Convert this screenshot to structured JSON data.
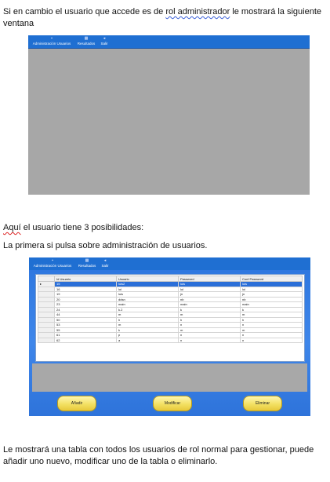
{
  "intro": {
    "text1": "Si en cambio el usuario que accede es de ",
    "text2": "rol  administrador",
    "text3": " le mostrará la siguiente ventana"
  },
  "window1": {
    "menu": [
      {
        "label": "Administración Usuarios",
        "icon": "users-icon"
      },
      {
        "label": "Resultados",
        "icon": "chart-icon"
      },
      {
        "label": "Salir",
        "icon": "exit-icon"
      }
    ]
  },
  "para2": {
    "word": "Aquí",
    "rest": " el usuario tiene 3 posibilidades:"
  },
  "para3": {
    "text": "La primera si pulsa sobre administración de usuarios."
  },
  "window2": {
    "menu": [
      {
        "label": "Administración Usuarios",
        "icon": "users-icon"
      },
      {
        "label": "Resultados",
        "icon": "chart-icon"
      },
      {
        "label": "Salir",
        "icon": "exit-icon"
      }
    ],
    "columns": [
      "Id Usuario",
      "Usuario",
      "Password",
      "Conf Password"
    ],
    "rows": [
      [
        "15",
        "luis2",
        "luis",
        "luis"
      ],
      [
        "16",
        "lol",
        "lol",
        "lol"
      ],
      [
        "19",
        "luis",
        "jn",
        "jn"
      ],
      [
        "20",
        "ddsn",
        "nb",
        "nb"
      ],
      [
        "23",
        "main",
        "main",
        "main"
      ],
      [
        "24",
        "k.2",
        "k",
        "k"
      ],
      [
        "44",
        "m",
        "m",
        "m"
      ],
      [
        "50",
        "h",
        "h",
        "h"
      ],
      [
        "53",
        "m",
        "n",
        "n"
      ],
      [
        "55",
        "k",
        "m",
        "m"
      ],
      [
        "61",
        "p",
        "n",
        "n"
      ],
      [
        "62",
        "a",
        "n",
        "n"
      ]
    ],
    "buttons": {
      "add": "Añadir",
      "modify": "Modificar",
      "delete": "Eliminar"
    }
  },
  "para4": {
    "text": "Le mostrará una tabla con todos los usuarios de rol normal para gestionar, puede añadir uno nuevo, modificar uno de la tabla o eliminarlo."
  }
}
